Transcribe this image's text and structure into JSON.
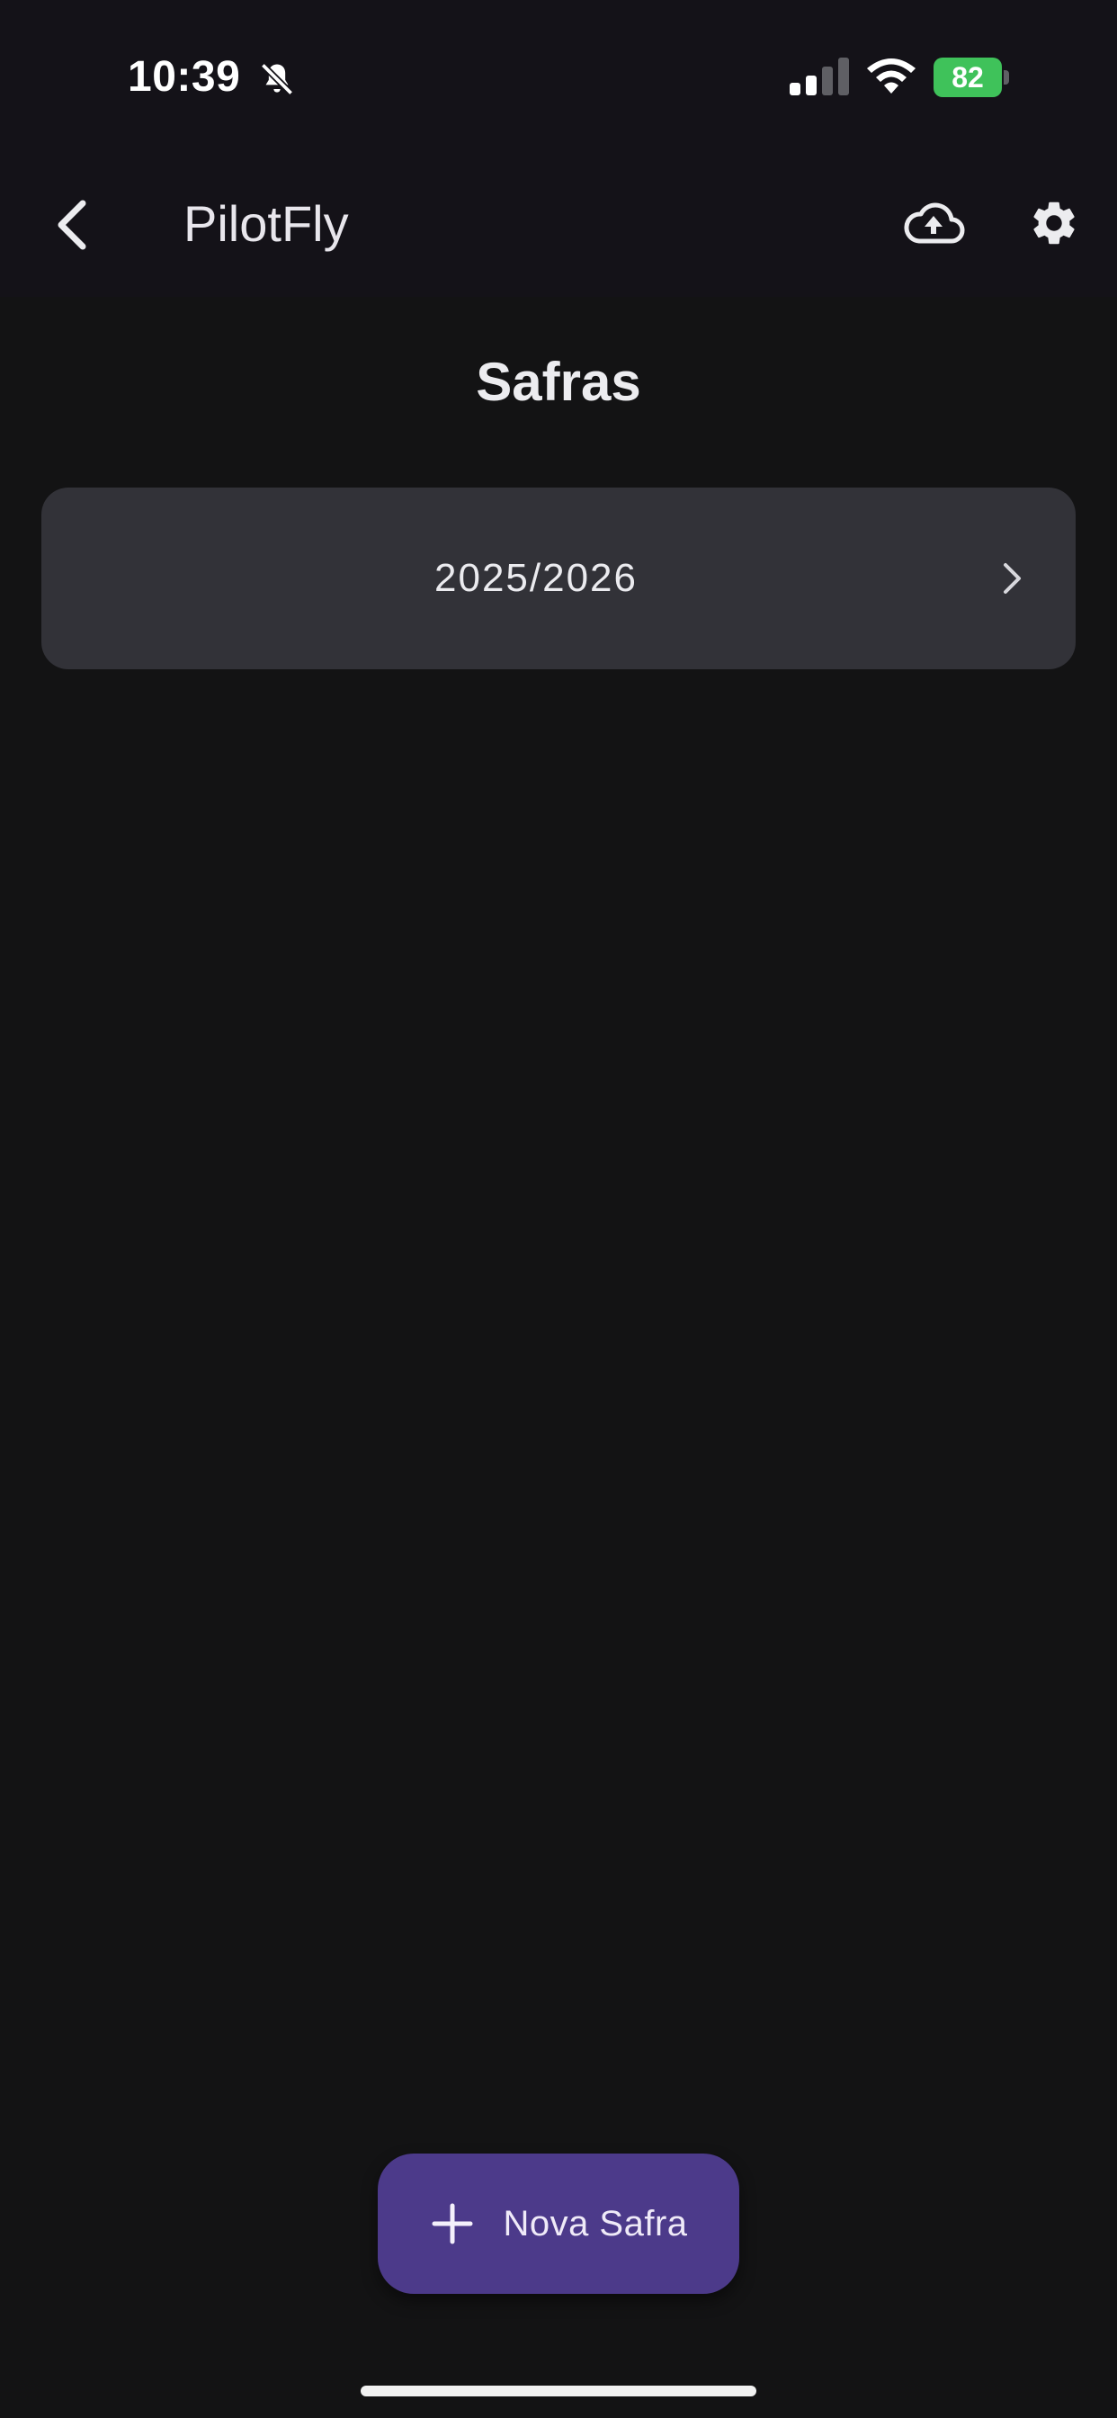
{
  "status_bar": {
    "time": "10:39",
    "battery_level": "82",
    "icons": [
      "bell-slash-icon",
      "signal-icon",
      "wifi-icon",
      "battery-charging-icon"
    ]
  },
  "app_bar": {
    "title": "PilotFly",
    "icons": [
      "back-arrow-icon",
      "cloud-upload-icon",
      "gear-icon"
    ]
  },
  "main": {
    "title": "Safras",
    "seasons": [
      {
        "label": "2025/2026"
      }
    ]
  },
  "fab": {
    "label": "Nova Safra",
    "icon": "plus-icon"
  },
  "colors": {
    "background": "#131314",
    "card": "#323238",
    "fab": "#4c3a8a",
    "battery": "#3fc25a"
  }
}
